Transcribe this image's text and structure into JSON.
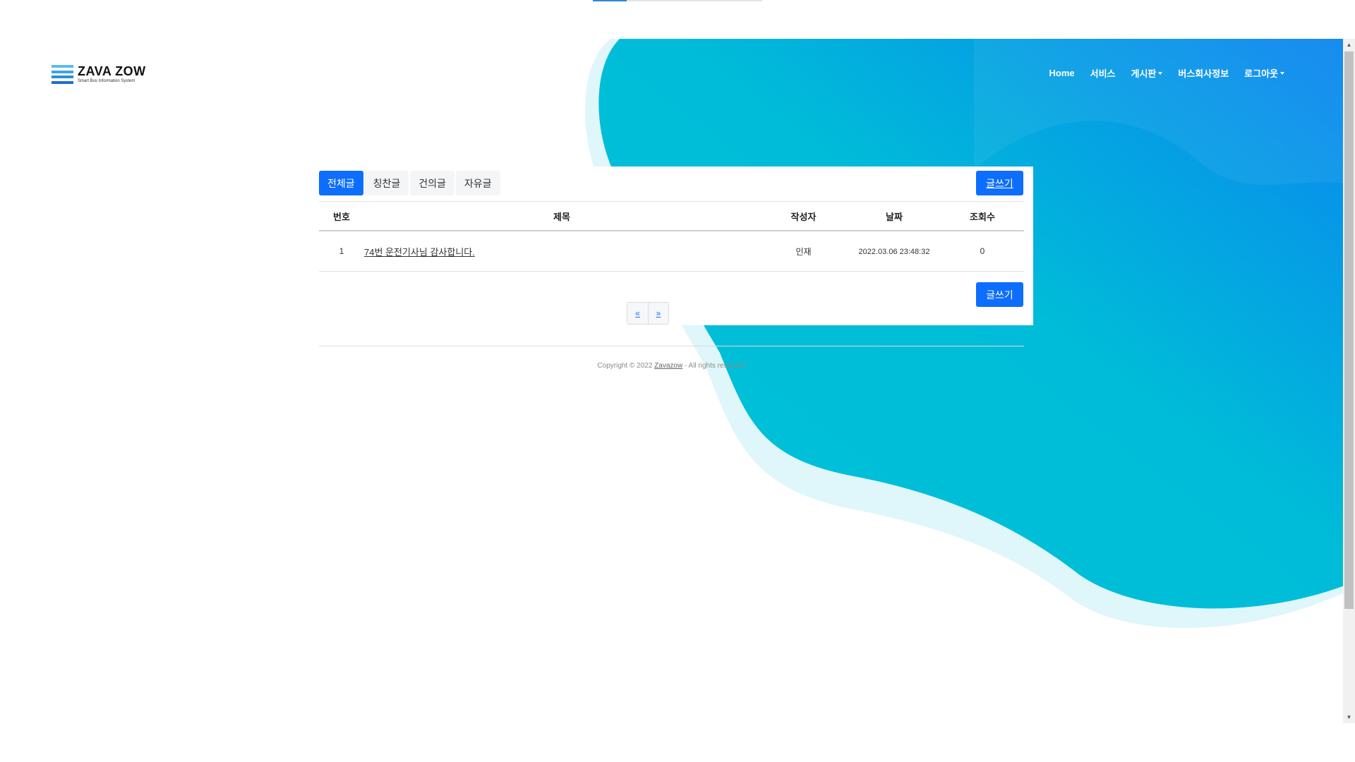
{
  "header": {
    "logo_title": "ZAVA ZOW",
    "logo_subtitle": "Smart Bus Information System",
    "nav": [
      {
        "label": "Home",
        "has_dropdown": false
      },
      {
        "label": "서비스",
        "has_dropdown": false
      },
      {
        "label": "게시판",
        "has_dropdown": true
      },
      {
        "label": "버스회사정보",
        "has_dropdown": false
      },
      {
        "label": "로그아웃",
        "has_dropdown": true
      }
    ]
  },
  "board": {
    "tabs": [
      {
        "label": "전체글",
        "active": true
      },
      {
        "label": "칭찬글",
        "active": false
      },
      {
        "label": "건의글",
        "active": false
      },
      {
        "label": "자유글",
        "active": false
      }
    ],
    "write_label": "글쓰기",
    "columns": {
      "no": "번호",
      "title": "제목",
      "writer": "작성자",
      "date": "날짜",
      "views": "조회수"
    },
    "rows": [
      {
        "no": "1",
        "title": "74번 운전기사님 감사합니다.",
        "writer": "인재",
        "date": "2022.03.06 23:48:32",
        "views": "0"
      }
    ],
    "pager": {
      "prev": "«",
      "next": "»"
    }
  },
  "footer": {
    "copyright_prefix": "Copyright © 2022 ",
    "brand_link": "Zavazow",
    "copyright_suffix": " - All rights reserved"
  },
  "colors": {
    "primary": "#0d6efd",
    "wave_start": "#00c2d8",
    "wave_end": "#0a84f0",
    "wave_light": "#dff6fa"
  }
}
